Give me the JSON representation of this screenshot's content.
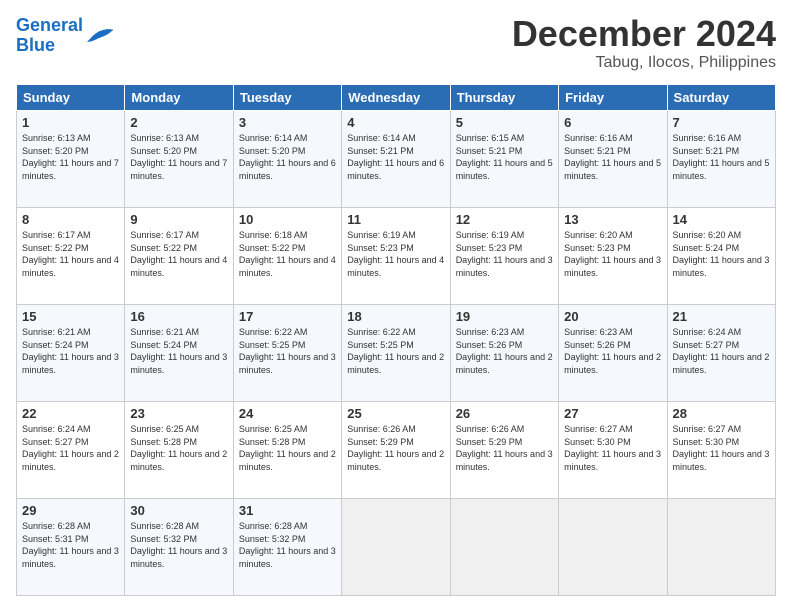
{
  "logo": {
    "line1": "General",
    "line2": "Blue"
  },
  "title": "December 2024",
  "location": "Tabug, Ilocos, Philippines",
  "headers": [
    "Sunday",
    "Monday",
    "Tuesday",
    "Wednesday",
    "Thursday",
    "Friday",
    "Saturday"
  ],
  "weeks": [
    [
      {
        "day": "1",
        "sunrise": "6:13 AM",
        "sunset": "5:20 PM",
        "daylight": "11 hours and 7 minutes."
      },
      {
        "day": "2",
        "sunrise": "6:13 AM",
        "sunset": "5:20 PM",
        "daylight": "11 hours and 7 minutes."
      },
      {
        "day": "3",
        "sunrise": "6:14 AM",
        "sunset": "5:20 PM",
        "daylight": "11 hours and 6 minutes."
      },
      {
        "day": "4",
        "sunrise": "6:14 AM",
        "sunset": "5:21 PM",
        "daylight": "11 hours and 6 minutes."
      },
      {
        "day": "5",
        "sunrise": "6:15 AM",
        "sunset": "5:21 PM",
        "daylight": "11 hours and 5 minutes."
      },
      {
        "day": "6",
        "sunrise": "6:16 AM",
        "sunset": "5:21 PM",
        "daylight": "11 hours and 5 minutes."
      },
      {
        "day": "7",
        "sunrise": "6:16 AM",
        "sunset": "5:21 PM",
        "daylight": "11 hours and 5 minutes."
      }
    ],
    [
      {
        "day": "8",
        "sunrise": "6:17 AM",
        "sunset": "5:22 PM",
        "daylight": "11 hours and 4 minutes."
      },
      {
        "day": "9",
        "sunrise": "6:17 AM",
        "sunset": "5:22 PM",
        "daylight": "11 hours and 4 minutes."
      },
      {
        "day": "10",
        "sunrise": "6:18 AM",
        "sunset": "5:22 PM",
        "daylight": "11 hours and 4 minutes."
      },
      {
        "day": "11",
        "sunrise": "6:19 AM",
        "sunset": "5:23 PM",
        "daylight": "11 hours and 4 minutes."
      },
      {
        "day": "12",
        "sunrise": "6:19 AM",
        "sunset": "5:23 PM",
        "daylight": "11 hours and 3 minutes."
      },
      {
        "day": "13",
        "sunrise": "6:20 AM",
        "sunset": "5:23 PM",
        "daylight": "11 hours and 3 minutes."
      },
      {
        "day": "14",
        "sunrise": "6:20 AM",
        "sunset": "5:24 PM",
        "daylight": "11 hours and 3 minutes."
      }
    ],
    [
      {
        "day": "15",
        "sunrise": "6:21 AM",
        "sunset": "5:24 PM",
        "daylight": "11 hours and 3 minutes."
      },
      {
        "day": "16",
        "sunrise": "6:21 AM",
        "sunset": "5:24 PM",
        "daylight": "11 hours and 3 minutes."
      },
      {
        "day": "17",
        "sunrise": "6:22 AM",
        "sunset": "5:25 PM",
        "daylight": "11 hours and 3 minutes."
      },
      {
        "day": "18",
        "sunrise": "6:22 AM",
        "sunset": "5:25 PM",
        "daylight": "11 hours and 2 minutes."
      },
      {
        "day": "19",
        "sunrise": "6:23 AM",
        "sunset": "5:26 PM",
        "daylight": "11 hours and 2 minutes."
      },
      {
        "day": "20",
        "sunrise": "6:23 AM",
        "sunset": "5:26 PM",
        "daylight": "11 hours and 2 minutes."
      },
      {
        "day": "21",
        "sunrise": "6:24 AM",
        "sunset": "5:27 PM",
        "daylight": "11 hours and 2 minutes."
      }
    ],
    [
      {
        "day": "22",
        "sunrise": "6:24 AM",
        "sunset": "5:27 PM",
        "daylight": "11 hours and 2 minutes."
      },
      {
        "day": "23",
        "sunrise": "6:25 AM",
        "sunset": "5:28 PM",
        "daylight": "11 hours and 2 minutes."
      },
      {
        "day": "24",
        "sunrise": "6:25 AM",
        "sunset": "5:28 PM",
        "daylight": "11 hours and 2 minutes."
      },
      {
        "day": "25",
        "sunrise": "6:26 AM",
        "sunset": "5:29 PM",
        "daylight": "11 hours and 2 minutes."
      },
      {
        "day": "26",
        "sunrise": "6:26 AM",
        "sunset": "5:29 PM",
        "daylight": "11 hours and 3 minutes."
      },
      {
        "day": "27",
        "sunrise": "6:27 AM",
        "sunset": "5:30 PM",
        "daylight": "11 hours and 3 minutes."
      },
      {
        "day": "28",
        "sunrise": "6:27 AM",
        "sunset": "5:30 PM",
        "daylight": "11 hours and 3 minutes."
      }
    ],
    [
      {
        "day": "29",
        "sunrise": "6:28 AM",
        "sunset": "5:31 PM",
        "daylight": "11 hours and 3 minutes."
      },
      {
        "day": "30",
        "sunrise": "6:28 AM",
        "sunset": "5:32 PM",
        "daylight": "11 hours and 3 minutes."
      },
      {
        "day": "31",
        "sunrise": "6:28 AM",
        "sunset": "5:32 PM",
        "daylight": "11 hours and 3 minutes."
      },
      null,
      null,
      null,
      null
    ]
  ],
  "labels": {
    "sunrise": "Sunrise:",
    "sunset": "Sunset:",
    "daylight": "Daylight:"
  }
}
